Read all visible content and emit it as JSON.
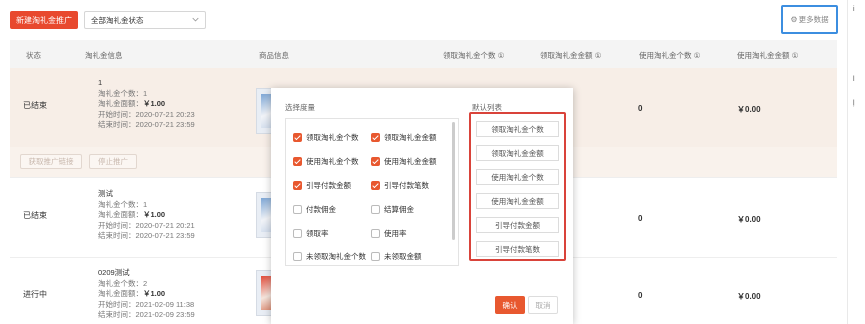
{
  "toolbar": {
    "new_button": "新建淘礼金推广",
    "status_filter": "全部淘礼金状态",
    "more_data": "更多数据"
  },
  "table": {
    "headers": [
      "状态",
      "淘礼金信息",
      "商品信息",
      "领取淘礼金个数 ①",
      "领取淘礼金金额 ①",
      "使用淘礼金个数 ①",
      "使用淘礼金金额 ①"
    ],
    "rows": [
      {
        "status": "已结束",
        "name": "1",
        "count": "淘礼金个数：1",
        "amount_label": "淘礼金面额：",
        "amount": "￥1.00",
        "start": "开始时间：2020-07-21 20:23",
        "end": "结束时间：2020-07-21 23:59",
        "used_count": "0",
        "used_amount": "￥0.00",
        "actions": [
          "获取推广链接",
          "停止推广"
        ]
      },
      {
        "status": "已结束",
        "name": "测试",
        "count": "淘礼金个数：1",
        "amount_label": "淘礼金面额：",
        "amount": "￥1.00",
        "start": "开始时间：2020-07-21 20:21",
        "end": "结束时间：2020-07-21 23:59",
        "used_count": "0",
        "used_amount": "￥0.00"
      },
      {
        "status": "进行中",
        "name": "0209测试",
        "count": "淘礼金个数：2",
        "amount_label": "淘礼金面额：",
        "amount": "￥1.00",
        "start": "开始时间：2021-02-09 11:38",
        "end": "结束时间：2021-02-09 23:59",
        "used_count": "0",
        "used_amount": "￥0.00"
      }
    ]
  },
  "modal": {
    "left_title": "选择度量",
    "right_title": "默认列表",
    "options": [
      {
        "label": "领取淘礼金个数",
        "checked": true
      },
      {
        "label": "领取淘礼金金额",
        "checked": true
      },
      {
        "label": "使用淘礼金个数",
        "checked": true
      },
      {
        "label": "使用淘礼金金额",
        "checked": true
      },
      {
        "label": "引导付款金额",
        "checked": true
      },
      {
        "label": "引导付款笔数",
        "checked": true
      },
      {
        "label": "付款佣金",
        "checked": false
      },
      {
        "label": "结算佣金",
        "checked": false
      },
      {
        "label": "领取率",
        "checked": false
      },
      {
        "label": "使用率",
        "checked": false
      },
      {
        "label": "未领取淘礼金个数",
        "checked": false
      },
      {
        "label": "未领取金额",
        "checked": false
      }
    ],
    "selected": [
      "领取淘礼金个数",
      "领取淘礼金金额",
      "使用淘礼金个数",
      "使用淘礼金金额",
      "引导付款金额",
      "引导付款笔数"
    ],
    "confirm": "确认",
    "cancel": "取消"
  },
  "side_glyphs": [
    "i",
    "l",
    "ļ"
  ],
  "colors": {
    "accent": "#e8582f",
    "highlight_blue": "#3c8ee0",
    "highlight_red": "#d9433a"
  }
}
